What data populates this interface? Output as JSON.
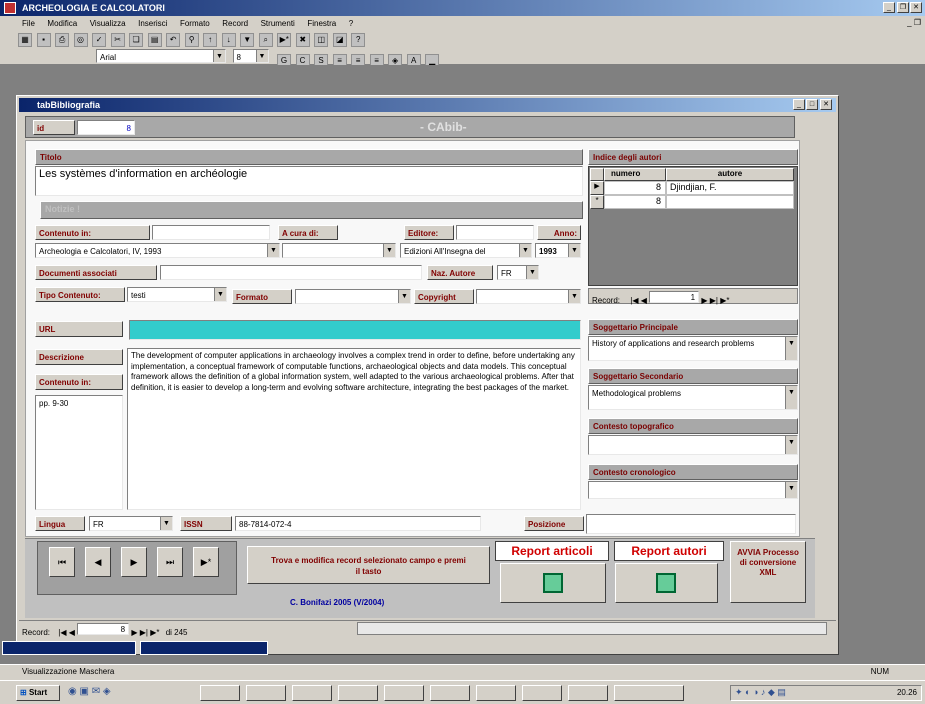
{
  "app": {
    "title": "ARCHEOLOGIA E CALCOLATORI",
    "menu": [
      "File",
      "Modifica",
      "Visualizza",
      "Inserisci",
      "Formato",
      "Record",
      "Strumenti",
      "Finestra",
      "?"
    ],
    "font_name": "Arial",
    "font_size": "8"
  },
  "form": {
    "title": "tabBibliografia",
    "id_label": "id",
    "id_value": "8",
    "header_text": "- CAbib-",
    "titolo_label": "Titolo",
    "titolo_value": "Les systèmes d'information en archéologie",
    "section_label": "Notizie !",
    "contenuto_label": "Contenuto in:",
    "contenuto_value": "Archeologia e Calcolatori, IV, 1993",
    "acura_label": "A cura di:",
    "acura_value": "",
    "editore_label": "Editore:",
    "editore_value": "Edizioni All'Insegna del",
    "anno_label": "Anno:",
    "anno_value": "1993",
    "doc_assoc_label": "Documenti associati",
    "doc_assoc_value": "",
    "naz_autore_label": "Naz. Autore",
    "naz_autore_value": "FR",
    "tipo_label": "Tipo Contenuto:",
    "tipo_value": "testi",
    "formato_label": "Formato",
    "formato_value": "",
    "copyright_label": "Copyright",
    "copyright_value": "",
    "url_label": "URL",
    "url_value": "",
    "descrizione_label": "Descrizione",
    "descrizione_value": "The development of computer applications in archaeology involves a complex trend in order to define, before undertaking any implementation, a conceptual framework of computable functions, archaeological objects and data models. This conceptual framework allows the definition of a global information system, well adapted to the various archaeological problems. After that definition, it is easier to develop a long-term and evolving software architecture, integrating the best packages of the market.",
    "contenuto_in_label": "Contenuto in:",
    "contenuto_in_value": "pp. 9-30",
    "lingua_label": "Lingua",
    "lingua_value": "FR",
    "issn_label": "ISSN",
    "issn_value": "88-7814-072-4",
    "posizione_label": "Posizione",
    "posizione_value": ""
  },
  "authors": {
    "header": "Indice degli autori",
    "col_numero": "numero",
    "col_autore": "autore",
    "rows": [
      {
        "marker": "▶",
        "numero": "8",
        "autore": "Djindjian, F."
      },
      {
        "marker": "*",
        "numero": "8",
        "autore": ""
      }
    ],
    "record_label": "Record:",
    "record_value": "1"
  },
  "subjects": {
    "principale_label": "Soggettario Principale",
    "principale_value": "History of applications and research problems",
    "secondario_label": "Soggettario Secondario",
    "secondario_value": "Methodological problems",
    "topografico_label": "Contesto topografico",
    "topografico_value": "",
    "cronologico_label": "Contesto cronologico",
    "cronologico_value": ""
  },
  "footer": {
    "search_button": "Trova e modifica record selezionato campo e premi il tasto",
    "report_articoli": "Report articoli",
    "report_autori": "Report autori",
    "avvia_button": "AVVIA Processo di conversione XML",
    "credit": "C. Bonifazi 2005 (V/2004)",
    "nav_first": "⏮",
    "nav_prev": "◀",
    "nav_next": "▶",
    "nav_last": "⏭",
    "nav_new": "▶*"
  },
  "recordbar": {
    "label": "Record:",
    "value": "8",
    "total": "di 245"
  },
  "statusbar": {
    "text": "Visualizzazione Maschera",
    "num": "NUM"
  },
  "taskbar": {
    "start": "Start",
    "clock": "20.26"
  }
}
